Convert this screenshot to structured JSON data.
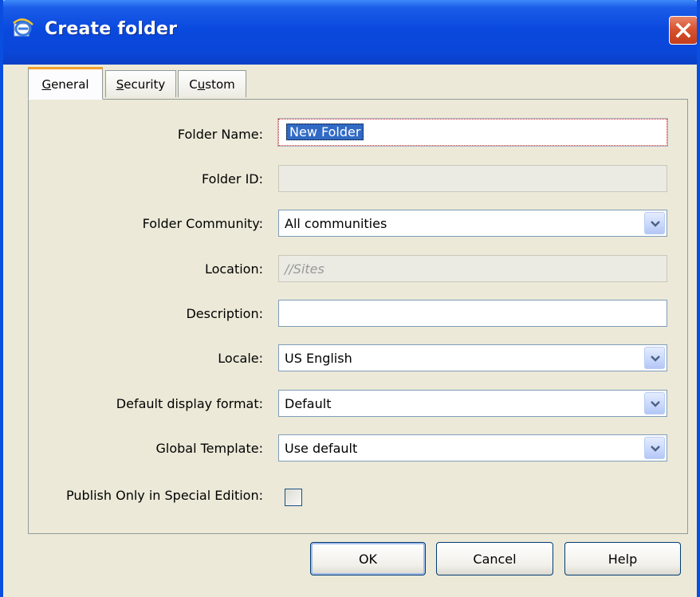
{
  "window": {
    "title": "Create folder",
    "icons": {
      "app": "ie-logo-icon",
      "close": "close-icon"
    }
  },
  "tabs": [
    {
      "label": "General",
      "mnemonic": "G",
      "rest": "eneral",
      "active": true
    },
    {
      "label": "Security",
      "mnemonic": "S",
      "rest": "ecurity",
      "active": false
    },
    {
      "label": "Custom",
      "pre": "C",
      "mnemonic": "u",
      "rest": "stom",
      "active": false
    }
  ],
  "form": {
    "folder_name": {
      "label": "Folder Name:",
      "value": "New Folder"
    },
    "folder_id": {
      "label": "Folder ID:",
      "value": ""
    },
    "folder_community": {
      "label": "Folder Community:",
      "value": "All communities"
    },
    "location": {
      "label": "Location:",
      "value": "//Sites"
    },
    "description": {
      "label": "Description:",
      "value": ""
    },
    "locale": {
      "label": "Locale:",
      "value": "US English"
    },
    "display_format": {
      "label": "Default display format:",
      "value": "Default"
    },
    "global_template": {
      "label": "Global Template:",
      "value": "Use default"
    },
    "publish_special": {
      "label": "Publish Only in Special Edition:",
      "checked": false
    }
  },
  "buttons": {
    "ok": "OK",
    "cancel": "Cancel",
    "help": "Help"
  },
  "colors": {
    "titlebar": "#0a49de",
    "tab_highlight": "#f1a12c",
    "selection": "#316ac5",
    "dialog_bg": "#ece9d8"
  }
}
